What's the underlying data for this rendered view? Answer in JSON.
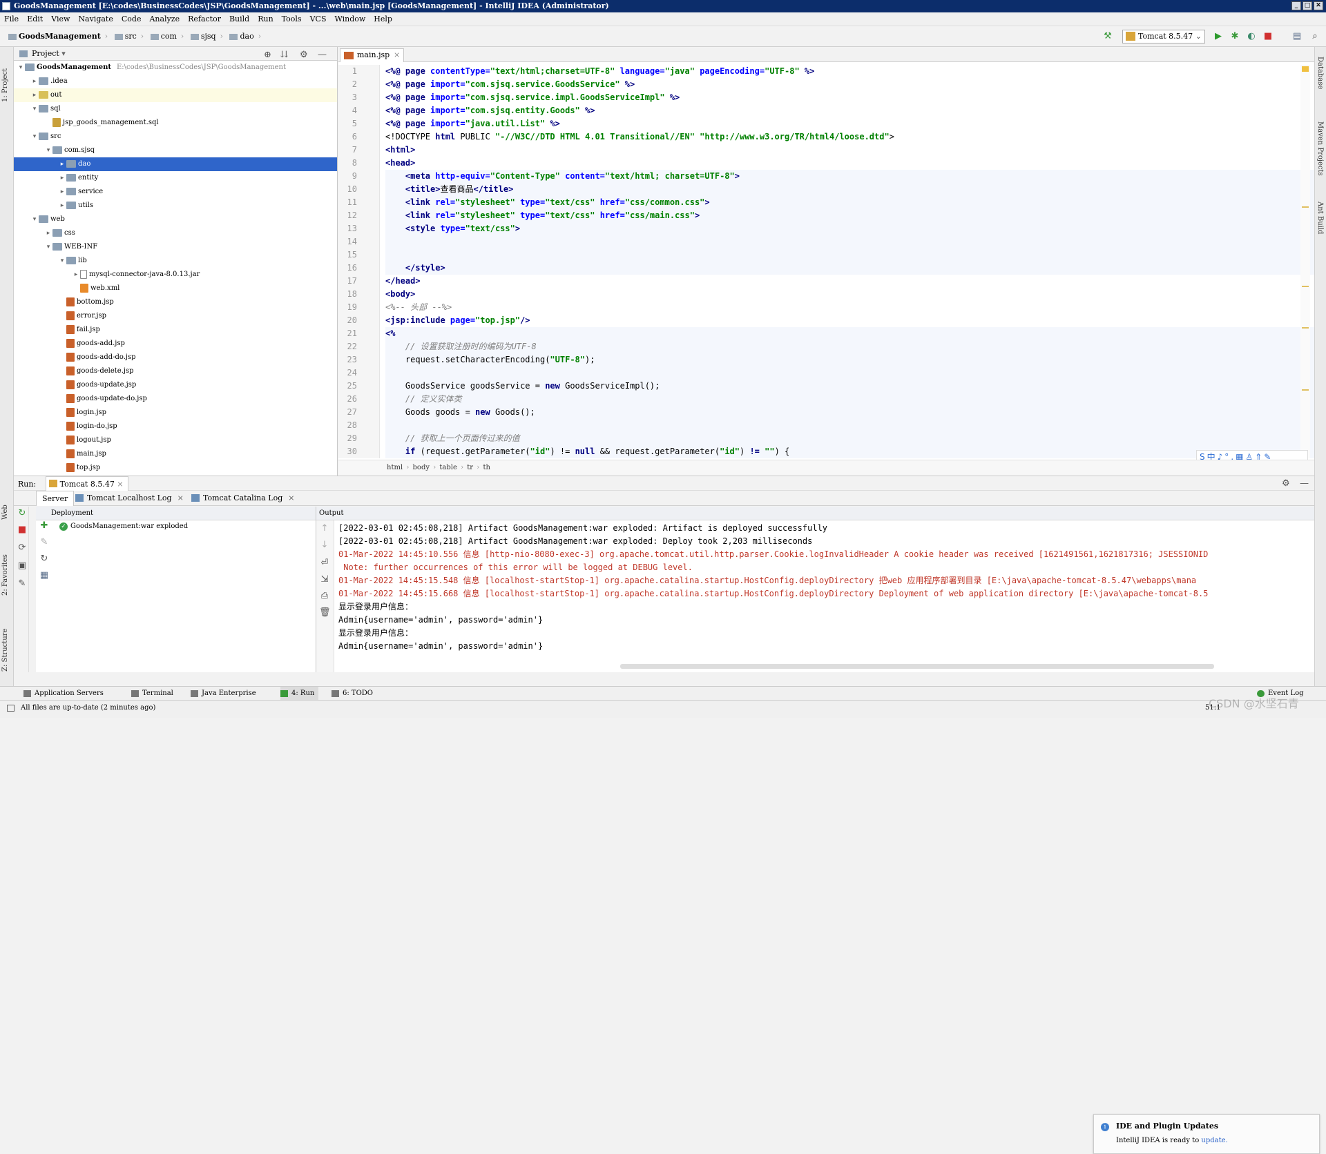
{
  "window": {
    "title": "GoodsManagement [E:\\codes\\BusinessCodes\\JSP\\GoodsManagement] - ...\\web\\main.jsp [GoodsManagement] - IntelliJ IDEA (Administrator)",
    "minimize": "_",
    "maximize": "□",
    "close": "✕"
  },
  "menu": [
    "File",
    "Edit",
    "View",
    "Navigate",
    "Code",
    "Analyze",
    "Refactor",
    "Build",
    "Run",
    "Tools",
    "VCS",
    "Window",
    "Help"
  ],
  "breadcrumb": {
    "root": "GoodsManagement",
    "items": [
      "src",
      "com",
      "sjsq",
      "dao"
    ]
  },
  "toolbar": {
    "run_config": "Tomcat 8.5.47"
  },
  "left_strip": {
    "project": "1: Project",
    "web": "Web",
    "favorites": "2: Favorites",
    "structure": "Z: Structure"
  },
  "right_strip": {
    "database": "Database",
    "maven": "Maven Projects",
    "ant": "Ant Build"
  },
  "project_panel": {
    "title": "Project",
    "tree": [
      {
        "label": "GoodsManagement",
        "path": "E:\\codes\\BusinessCodes\\JSP\\GoodsManagement",
        "depth": 0,
        "arrow": "▾",
        "icon": "folder"
      },
      {
        "label": ".idea",
        "path": "",
        "depth": 1,
        "arrow": "▸",
        "icon": "folder"
      },
      {
        "label": "out",
        "path": "",
        "depth": 1,
        "arrow": "▸",
        "icon": "folder-y"
      },
      {
        "label": "sql",
        "path": "",
        "depth": 1,
        "arrow": "▾",
        "icon": "folder"
      },
      {
        "label": "jsp_goods_management.sql",
        "path": "",
        "depth": 2,
        "arrow": "",
        "icon": "sql"
      },
      {
        "label": "src",
        "path": "",
        "depth": 1,
        "arrow": "▾",
        "icon": "folder"
      },
      {
        "label": "com.sjsq",
        "path": "",
        "depth": 2,
        "arrow": "▾",
        "icon": "folder"
      },
      {
        "label": "dao",
        "path": "",
        "depth": 3,
        "arrow": "▸",
        "icon": "folder"
      },
      {
        "label": "entity",
        "path": "",
        "depth": 3,
        "arrow": "▸",
        "icon": "folder"
      },
      {
        "label": "service",
        "path": "",
        "depth": 3,
        "arrow": "▸",
        "icon": "folder"
      },
      {
        "label": "utils",
        "path": "",
        "depth": 3,
        "arrow": "▸",
        "icon": "folder"
      },
      {
        "label": "web",
        "path": "",
        "depth": 1,
        "arrow": "▾",
        "icon": "folder"
      },
      {
        "label": "css",
        "path": "",
        "depth": 2,
        "arrow": "▸",
        "icon": "folder"
      },
      {
        "label": "WEB-INF",
        "path": "",
        "depth": 2,
        "arrow": "▾",
        "icon": "folder"
      },
      {
        "label": "lib",
        "path": "",
        "depth": 3,
        "arrow": "▾",
        "icon": "folder"
      },
      {
        "label": "mysql-connector-java-8.0.13.jar",
        "path": "",
        "depth": 4,
        "arrow": "▸",
        "icon": "jar"
      },
      {
        "label": "web.xml",
        "path": "",
        "depth": 4,
        "arrow": "",
        "icon": "xml"
      },
      {
        "label": "bottom.jsp",
        "path": "",
        "depth": 3,
        "arrow": "",
        "icon": "file"
      },
      {
        "label": "error.jsp",
        "path": "",
        "depth": 3,
        "arrow": "",
        "icon": "file"
      },
      {
        "label": "fail.jsp",
        "path": "",
        "depth": 3,
        "arrow": "",
        "icon": "file"
      },
      {
        "label": "goods-add.jsp",
        "path": "",
        "depth": 3,
        "arrow": "",
        "icon": "file"
      },
      {
        "label": "goods-add-do.jsp",
        "path": "",
        "depth": 3,
        "arrow": "",
        "icon": "file"
      },
      {
        "label": "goods-delete.jsp",
        "path": "",
        "depth": 3,
        "arrow": "",
        "icon": "file"
      },
      {
        "label": "goods-update.jsp",
        "path": "",
        "depth": 3,
        "arrow": "",
        "icon": "file"
      },
      {
        "label": "goods-update-do.jsp",
        "path": "",
        "depth": 3,
        "arrow": "",
        "icon": "file"
      },
      {
        "label": "login.jsp",
        "path": "",
        "depth": 3,
        "arrow": "",
        "icon": "file"
      },
      {
        "label": "login-do.jsp",
        "path": "",
        "depth": 3,
        "arrow": "",
        "icon": "file"
      },
      {
        "label": "logout.jsp",
        "path": "",
        "depth": 3,
        "arrow": "",
        "icon": "file"
      },
      {
        "label": "main.jsp",
        "path": "",
        "depth": 3,
        "arrow": "",
        "icon": "file"
      },
      {
        "label": "top.jsp",
        "path": "",
        "depth": 3,
        "arrow": "",
        "icon": "file"
      }
    ],
    "selected_index": 7,
    "highlight_index": 2
  },
  "editor": {
    "tab": "main.jsp",
    "lines": [
      [
        [
          "<%@ ",
          "tag"
        ],
        [
          "page ",
          "tag"
        ],
        [
          "contentType=",
          "att"
        ],
        [
          "\"text/html;charset=UTF-8\" ",
          "str"
        ],
        [
          "language=",
          "att"
        ],
        [
          "\"java\" ",
          "str"
        ],
        [
          "pageEncoding=",
          "att"
        ],
        [
          "\"UTF-8\" ",
          "str"
        ],
        [
          "%>",
          "tag"
        ]
      ],
      [
        [
          "<%@ ",
          "tag"
        ],
        [
          "page ",
          "tag"
        ],
        [
          "import=",
          "att"
        ],
        [
          "\"com.sjsq.service.GoodsService\" ",
          "str"
        ],
        [
          "%>",
          "tag"
        ]
      ],
      [
        [
          "<%@ ",
          "tag"
        ],
        [
          "page ",
          "tag"
        ],
        [
          "import=",
          "att"
        ],
        [
          "\"com.sjsq.service.impl.GoodsServiceImpl\" ",
          "str"
        ],
        [
          "%>",
          "tag"
        ]
      ],
      [
        [
          "<%@ ",
          "tag"
        ],
        [
          "page ",
          "tag"
        ],
        [
          "import=",
          "att"
        ],
        [
          "\"com.sjsq.entity.Goods\" ",
          "str"
        ],
        [
          "%>",
          "tag"
        ]
      ],
      [
        [
          "<%@ ",
          "tag"
        ],
        [
          "page ",
          "tag"
        ],
        [
          "import=",
          "att"
        ],
        [
          "\"java.util.List\" ",
          "str"
        ],
        [
          "%>",
          "tag"
        ]
      ],
      [
        [
          "<!DOCTYPE ",
          ""
        ],
        [
          "html ",
          "tag"
        ],
        [
          "PUBLIC ",
          ""
        ],
        [
          "\"-//W3C//DTD HTML 4.01 Transitional//EN\" ",
          "str"
        ],
        [
          "\"http://www.w3.org/TR/html4/loose.dtd\"",
          "str"
        ],
        [
          ">",
          ""
        ]
      ],
      [
        [
          "<html>",
          "tag"
        ]
      ],
      [
        [
          "<head>",
          "tag"
        ]
      ],
      [
        [
          "    <meta ",
          "tag"
        ],
        [
          "http-equiv=",
          "att"
        ],
        [
          "\"Content-Type\" ",
          "str"
        ],
        [
          "content=",
          "att"
        ],
        [
          "\"text/html; charset=UTF-8\"",
          "str"
        ],
        [
          ">",
          "tag"
        ]
      ],
      [
        [
          "    <title>",
          "tag"
        ],
        [
          "查看商品",
          ""
        ],
        [
          "</title>",
          "tag"
        ]
      ],
      [
        [
          "    <link ",
          "tag"
        ],
        [
          "rel=",
          "att"
        ],
        [
          "\"stylesheet\" ",
          "str"
        ],
        [
          "type=",
          "att"
        ],
        [
          "\"text/css\" ",
          "str"
        ],
        [
          "href=",
          "att"
        ],
        [
          "\"css/common.css\"",
          "str"
        ],
        [
          ">",
          "tag"
        ]
      ],
      [
        [
          "    <link ",
          "tag"
        ],
        [
          "rel=",
          "att"
        ],
        [
          "\"stylesheet\" ",
          "str"
        ],
        [
          "type=",
          "att"
        ],
        [
          "\"text/css\" ",
          "str"
        ],
        [
          "href=",
          "att"
        ],
        [
          "\"css/main.css\"",
          "str"
        ],
        [
          ">",
          "tag"
        ]
      ],
      [
        [
          "    <style ",
          "tag"
        ],
        [
          "type=",
          "att"
        ],
        [
          "\"text/css\"",
          "str"
        ],
        [
          ">",
          "tag"
        ]
      ],
      [
        [
          "",
          ""
        ]
      ],
      [
        [
          "",
          ""
        ]
      ],
      [
        [
          "    </style>",
          "tag"
        ]
      ],
      [
        [
          "</head>",
          "tag"
        ]
      ],
      [
        [
          "<body>",
          "tag"
        ]
      ],
      [
        [
          "<%-- 头部 --%>",
          "cmt"
        ]
      ],
      [
        [
          "<jsp:include ",
          "tag"
        ],
        [
          "page=",
          "att"
        ],
        [
          "\"top.jsp\"",
          "str"
        ],
        [
          "/>",
          "tag"
        ]
      ],
      [
        [
          "<%",
          "tag"
        ]
      ],
      [
        [
          "    // 设置获取注册时的编码为UTF-8",
          "cmt"
        ]
      ],
      [
        [
          "    request.setCharacterEncoding(",
          ""
        ],
        [
          "\"UTF-8\"",
          "str"
        ],
        [
          ");",
          ""
        ]
      ],
      [
        [
          "",
          ""
        ]
      ],
      [
        [
          "    GoodsService goodsService = ",
          ""
        ],
        [
          "new ",
          "kw"
        ],
        [
          "GoodsServiceImpl();",
          ""
        ]
      ],
      [
        [
          "    // 定义实体类",
          "cmt"
        ]
      ],
      [
        [
          "    Goods goods = ",
          ""
        ],
        [
          "new ",
          "kw"
        ],
        [
          "Goods();",
          ""
        ]
      ],
      [
        [
          "",
          ""
        ]
      ],
      [
        [
          "    // 获取上一个页面传过来的值",
          "cmt"
        ]
      ],
      [
        [
          "    ",
          ""
        ],
        [
          "if ",
          "kw"
        ],
        [
          "(request.getParameter(",
          ""
        ],
        [
          "\"id\"",
          "str"
        ],
        [
          ") != ",
          ""
        ],
        [
          "null ",
          "kw"
        ],
        [
          "&& request.getParameter(",
          ""
        ],
        [
          "\"id\"",
          "str"
        ],
        [
          ") ",
          ""
        ],
        [
          "!= ",
          "kw"
        ],
        [
          "\"\"",
          "str"
        ],
        [
          ") {",
          ""
        ]
      ]
    ],
    "path_crumbs": [
      "html",
      "body",
      "table",
      "tr",
      "th"
    ],
    "ime_text": "S中♪°,▦♙⇑✎"
  },
  "run_panel": {
    "label": "Run:",
    "config_tab": "Tomcat 8.5.47",
    "subtabs": [
      "Server",
      "Tomcat Localhost Log",
      "Tomcat Catalina Log"
    ],
    "deployment_header": "Deployment",
    "deployment_item": "GoodsManagement:war exploded",
    "output_header": "Output",
    "output": [
      {
        "text": "[2022-03-01 02:45:08,218] Artifact GoodsManagement:war exploded: Artifact is deployed successfully",
        "c": "blk"
      },
      {
        "text": "[2022-03-01 02:45:08,218] Artifact GoodsManagement:war exploded: Deploy took 2,203 milliseconds",
        "c": "blk"
      },
      {
        "text": "01-Mar-2022 14:45:10.556 信息 [http-nio-8080-exec-3] org.apache.tomcat.util.http.parser.Cookie.logInvalidHeader A cookie header was received [1621491561,1621817316; JSESSIONID",
        "c": "red"
      },
      {
        "text": " Note: further occurrences of this error will be logged at DEBUG level.",
        "c": "red"
      },
      {
        "text": "01-Mar-2022 14:45:15.548 信息 [localhost-startStop-1] org.apache.catalina.startup.HostConfig.deployDirectory 把web 应用程序部署到目录 [E:\\java\\apache-tomcat-8.5.47\\webapps\\mana",
        "c": "red"
      },
      {
        "text": "01-Mar-2022 14:45:15.668 信息 [localhost-startStop-1] org.apache.catalina.startup.HostConfig.deployDirectory Deployment of web application directory [E:\\java\\apache-tomcat-8.5",
        "c": "red"
      },
      {
        "text": "显示登录用户信息：",
        "c": "blk"
      },
      {
        "text": "Admin{username='admin', password='admin'}",
        "c": "blk"
      },
      {
        "text": "显示登录用户信息：",
        "c": "blk"
      },
      {
        "text": "Admin{username='admin', password='admin'}",
        "c": "blk"
      }
    ]
  },
  "notification": {
    "title": "IDE and Plugin Updates",
    "body": "IntelliJ IDEA is ready to ",
    "link": "update."
  },
  "bottom_tabs": [
    "Application Servers",
    "Terminal",
    "Java Enterprise",
    "4: Run",
    "6: TODO"
  ],
  "event_log": "Event Log",
  "status": {
    "message": "All files are up-to-date (2 minutes ago)",
    "position": "51:1"
  },
  "watermark": "CSDN @水坚石青"
}
